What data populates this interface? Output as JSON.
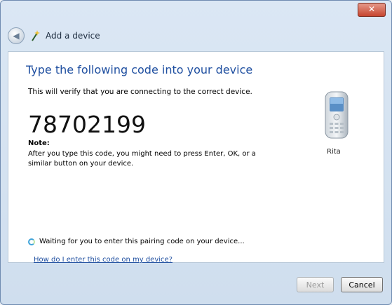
{
  "titlebar": {
    "close_label": "✕"
  },
  "nav": {
    "title": "Add a device"
  },
  "main": {
    "heading": "Type the following code into your device",
    "description": "This will verify that you are connecting to the correct device.",
    "code": "78702199",
    "note_label": "Note:",
    "note_text": "After you type this code, you might need to press Enter, OK, or a similar button on your device.",
    "device_name": "Rita",
    "waiting_text": "Waiting for you to enter this pairing code on your device...",
    "help_link": "How do I enter this code on my device?"
  },
  "footer": {
    "next_label": "Next",
    "cancel_label": "Cancel"
  },
  "colors": {
    "heading": "#1f4fa0",
    "close": "#c6452f"
  }
}
